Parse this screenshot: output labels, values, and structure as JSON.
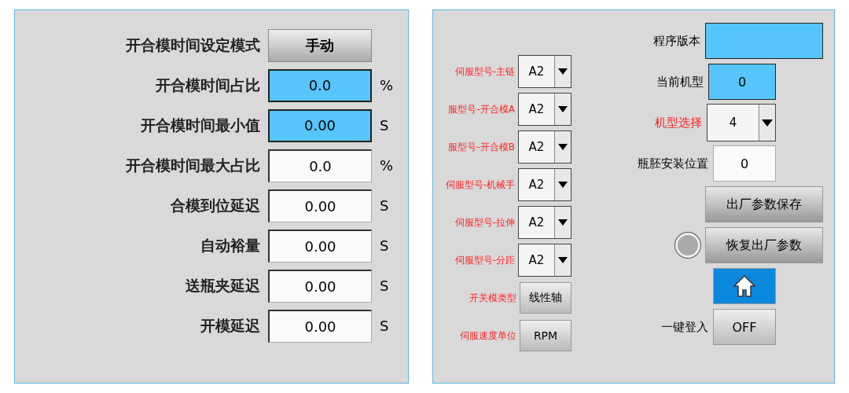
{
  "left_panel": {
    "mode": {
      "label": "开合模时间设定模式",
      "button": "手动"
    },
    "rows": [
      {
        "label": "开合模时间占比",
        "value": "0.0",
        "unit": "%",
        "kind": "display"
      },
      {
        "label": "开合模时间最小值",
        "value": "0.00",
        "unit": "S",
        "kind": "display"
      },
      {
        "label": "开合模时间最大占比",
        "value": "0.0",
        "unit": "%",
        "kind": "input"
      },
      {
        "label": "合模到位延迟",
        "value": "0.00",
        "unit": "S",
        "kind": "input"
      },
      {
        "label": "自动裕量",
        "value": "0.00",
        "unit": "S",
        "kind": "input"
      },
      {
        "label": "送瓶夹延迟",
        "value": "0.00",
        "unit": "S",
        "kind": "input"
      },
      {
        "label": "开模延迟",
        "value": "0.00",
        "unit": "S",
        "kind": "input"
      }
    ]
  },
  "right_panel": {
    "servo_rows": [
      {
        "label": "伺服型号-主链",
        "value": "A2",
        "kind": "dropdown"
      },
      {
        "label": "服型号-开合模A",
        "value": "A2",
        "kind": "dropdown"
      },
      {
        "label": "服型号-开合模B",
        "value": "A2",
        "kind": "dropdown"
      },
      {
        "label": "伺服型号-机械手",
        "value": "A2",
        "kind": "dropdown"
      },
      {
        "label": "伺服型号-拉伸",
        "value": "A2",
        "kind": "dropdown"
      },
      {
        "label": "伺服型号-分距",
        "value": "A2",
        "kind": "dropdown"
      },
      {
        "label": "开关模类型",
        "value": "线性轴",
        "kind": "button"
      },
      {
        "label": "伺服速度单位",
        "value": "RPM",
        "kind": "button"
      }
    ],
    "machine_rows": [
      {
        "label": "程序版本",
        "kind": "display",
        "highlighted": false
      },
      {
        "label": "当前机型",
        "value": "0",
        "kind": "display",
        "highlighted": false
      },
      {
        "label": "机型选择",
        "value": "4",
        "kind": "dropdown",
        "highlighted": true
      },
      {
        "label": "瓶胚安装位置",
        "value": "0",
        "kind": "input",
        "highlighted": false
      },
      {
        "value": "出厂参数保存",
        "kind": "wide_button"
      },
      {
        "value": "恢复出厂参数",
        "kind": "wide_button",
        "lamp_on": false
      },
      {
        "kind": "home"
      },
      {
        "label": "一键登入",
        "value": "OFF",
        "kind": "button",
        "highlighted": false
      }
    ]
  }
}
